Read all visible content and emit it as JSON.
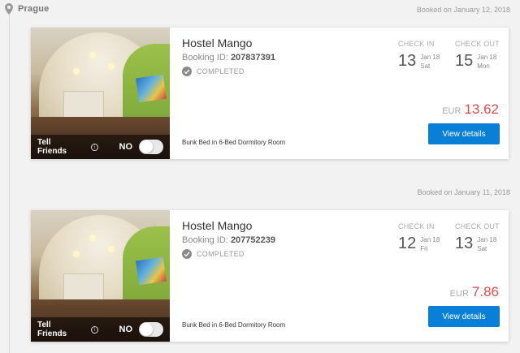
{
  "location": "Prague",
  "bookings": [
    {
      "booked_on": "Booked on January 12, 2018",
      "hotel_name": "Hostel Mango",
      "booking_id_label": "Booking ID:",
      "booking_id": "207837391",
      "status": "COMPLETED",
      "room_type": "Bunk Bed in 6-Bed Dormitory Room",
      "check_in_label": "CHECK IN",
      "check_in_day": "13",
      "check_in_month": "Jan 18",
      "check_in_weekday": "Sat",
      "check_out_label": "CHECK OUT",
      "check_out_day": "15",
      "check_out_month": "Jan 18",
      "check_out_weekday": "Mon",
      "currency": "EUR",
      "amount": "13.62",
      "view_label": "View details",
      "tell_friends": "Tell Friends",
      "toggle_label": "NO"
    },
    {
      "booked_on": "Booked on January 11, 2018",
      "hotel_name": "Hostel Mango",
      "booking_id_label": "Booking ID:",
      "booking_id": "207752239",
      "status": "COMPLETED",
      "room_type": "Bunk Bed in 6-Bed Dormitory Room",
      "check_in_label": "CHECK IN",
      "check_in_day": "12",
      "check_in_month": "Jan 18",
      "check_in_weekday": "Fri",
      "check_out_label": "CHECK OUT",
      "check_out_day": "13",
      "check_out_month": "Jan 18",
      "check_out_weekday": "Sat",
      "currency": "EUR",
      "amount": "7.86",
      "view_label": "View details",
      "tell_friends": "Tell Friends",
      "toggle_label": "NO"
    }
  ],
  "colors": {
    "accent": "#0a7fd7",
    "price": "#e24b4b"
  },
  "icons": {
    "location": "map-pin-icon",
    "status": "check-circle-icon",
    "info": "info-icon"
  }
}
